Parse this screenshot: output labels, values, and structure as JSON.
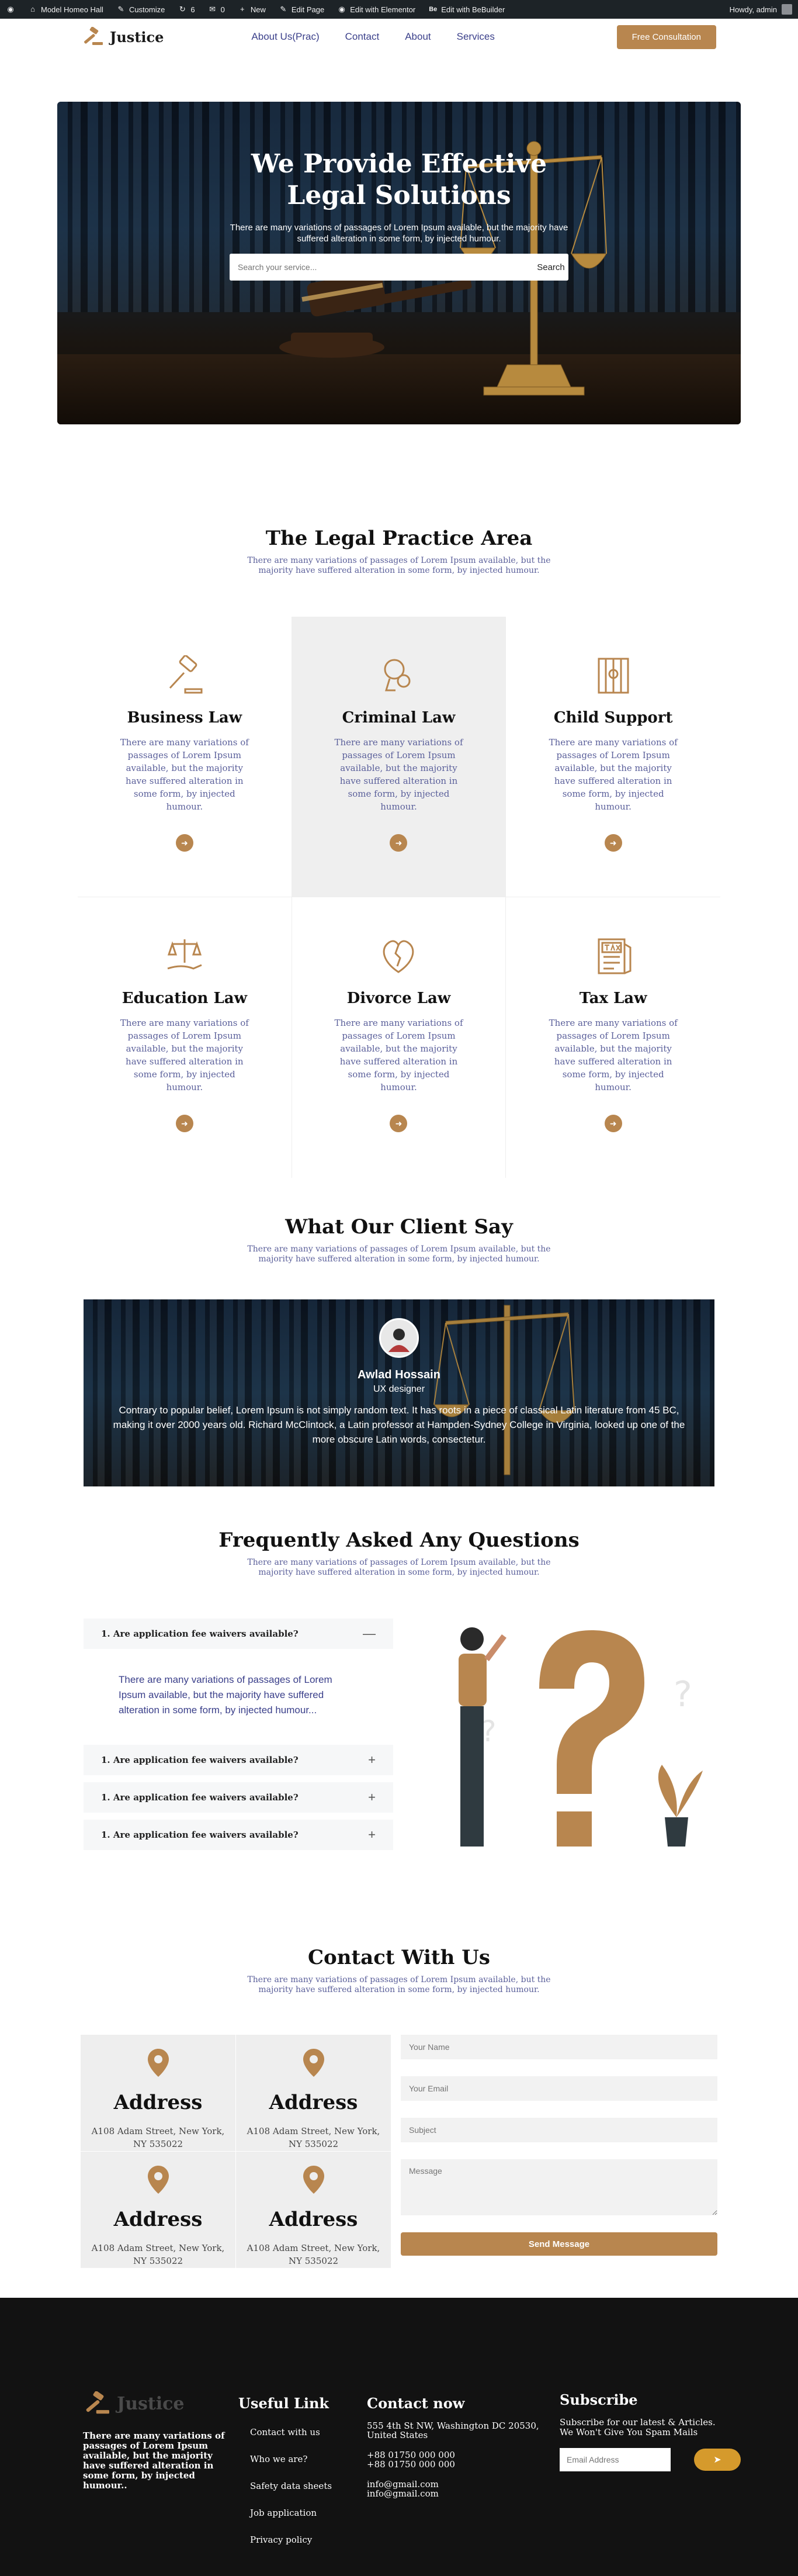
{
  "adminbar": {
    "site_name": "Model Homeo Hall",
    "customize": "Customize",
    "updates": "6",
    "comments": "0",
    "new": "New",
    "edit_page": "Edit Page",
    "elementor": "Edit with Elementor",
    "beaver": "Edit with BeBuilder",
    "howdy": "Howdy, admin"
  },
  "header": {
    "logo": "Justice",
    "nav": [
      "About Us(Prac)",
      "Contact",
      "About",
      "Services"
    ],
    "cta": "Free Consultation"
  },
  "hero": {
    "title_line1": "We Provide Effective",
    "title_line2": "Legal Solutions",
    "subtitle": "There are many variations of passages of Lorem Ipsum available, but the majority have suffered alteration in some form, by injected humour.",
    "search_placeholder": "Search your service...",
    "search_button": "Search"
  },
  "practice": {
    "title": "The Legal Practice Area",
    "subtitle": "There are many variations of passages of Lorem Ipsum available, but the majority have suffered alteration in some form, by injected humour.",
    "cards": [
      {
        "title": "Business Law",
        "text": "There are many variations of passages of Lorem Ipsum available, but the majority have suffered alteration in some form, by injected humour.",
        "icon": "gavel-icon"
      },
      {
        "title": "Criminal Law",
        "text": "There are many variations of passages of Lorem Ipsum available, but the majority have suffered alteration in some form, by injected humour.",
        "icon": "handcuffs-icon"
      },
      {
        "title": "Child Support",
        "text": "There are many variations of passages of Lorem Ipsum available, but the majority have suffered alteration in some form, by injected humour.",
        "icon": "jail-icon"
      },
      {
        "title": "Education Law",
        "text": "There are many variations of passages of Lorem Ipsum available, but the majority have suffered alteration in some form, by injected humour.",
        "icon": "scale-hand-icon"
      },
      {
        "title": "Divorce Law",
        "text": "There are many variations of passages of Lorem Ipsum available, but the majority have suffered alteration in some form, by injected humour.",
        "icon": "broken-heart-icon"
      },
      {
        "title": "Tax Law",
        "text": "There are many variations of passages of Lorem Ipsum available, but the majority have suffered alteration in some form, by injected humour.",
        "icon": "tax-document-icon"
      }
    ]
  },
  "testimonials": {
    "title": "What Our Client Say",
    "subtitle": "There are many variations of passages of Lorem Ipsum available, but the majority have suffered alteration in some form, by injected humour.",
    "name": "Awlad Hossain",
    "role": "UX designer",
    "quote": "Contrary to popular belief, Lorem Ipsum is not simply random text. It has roots in a piece of classical Latin literature from 45 BC, making it over 2000 years old. Richard McClintock, a Latin professor at Hampden-Sydney College in Virginia, looked up one of the more obscure Latin words, consectetur."
  },
  "faq": {
    "title": "Frequently Asked Any Questions",
    "subtitle": "There are many variations of passages of Lorem Ipsum available, but the majority have suffered alteration in some form, by injected humour.",
    "open_answer": "There are many variations of passages of Lorem Ipsum available, but the majority have suffered alteration in some form, by injected humour...",
    "items": [
      "1. Are application fee waivers available?",
      "1. Are application fee waivers available?",
      "1. Are application fee waivers available?",
      "1. Are application fee waivers available?"
    ]
  },
  "contact": {
    "title": "Contact With Us",
    "subtitle": "There are many variations of passages of Lorem Ipsum available, but the majority have suffered alteration in some form, by injected humour.",
    "addresses": [
      {
        "title": "Address",
        "text": "A108 Adam Street, New York, NY 535022"
      },
      {
        "title": "Address",
        "text": "A108 Adam Street, New York, NY 535022"
      },
      {
        "title": "Address",
        "text": "A108 Adam Street, New York, NY 535022"
      },
      {
        "title": "Address",
        "text": "A108 Adam Street, New York, NY 535022"
      }
    ],
    "form": {
      "name": "Your Name",
      "email": "Your Email",
      "subject": "Subject",
      "message": "Message",
      "submit": "Send Message"
    }
  },
  "footer": {
    "logo": "Justice",
    "about": "There are many variations of passages of Lorem Ipsum available, but the majority have suffered alteration in some form, by injected humour..",
    "links_title": "Useful Link",
    "links": [
      "Contact with us",
      "Who we are?",
      "Safety data sheets",
      "Job application",
      "Privacy policy"
    ],
    "contact_title": "Contact now",
    "address": "555 4th St NW, Washington DC 20530, United States",
    "phone1": "+88 01750 000 000",
    "phone2": "+88 01750 000 000",
    "email1": "info@gmail.com",
    "email2": "info@gmail.com",
    "subscribe_title": "Subscribe",
    "subscribe_text": "Subscribe for our latest & Articles. We Won't Give You Spam Mails",
    "email_placeholder": "Email Address"
  },
  "colors": {
    "accent": "#b8864f",
    "dark": "#121212",
    "link": "#3a3f8a",
    "subscribe_button": "#d59a2c"
  }
}
